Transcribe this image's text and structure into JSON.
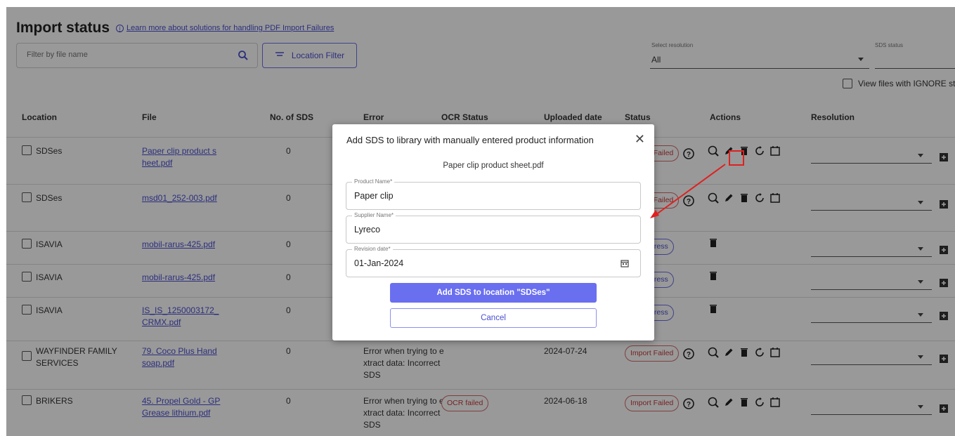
{
  "header": {
    "title": "Import status",
    "info_link": "Learn more about solutions for handling PDF Import Failures"
  },
  "filters": {
    "search_placeholder": "Filter by file name",
    "location_filter_label": "Location Filter",
    "resolution_label": "Select resolution",
    "resolution_value": "All",
    "sds_status_label": "SDS status",
    "ignore_label": "View files with IGNORE st"
  },
  "table": {
    "columns": [
      "Location",
      "File",
      "No. of SDS",
      "Error",
      "OCR Status",
      "Uploaded date",
      "Status",
      "Actions",
      "Resolution"
    ],
    "rows": [
      {
        "location": "SDSes",
        "file": "Paper clip product sheet.pdf",
        "nsds": "0",
        "error": "",
        "ocr": "",
        "date": "",
        "status": "Import Failed",
        "actions": "full"
      },
      {
        "location": "SDSes",
        "file": "msd01_252-003.pdf",
        "nsds": "0",
        "error": "",
        "ocr": "",
        "date": "",
        "status": "Import Failed",
        "actions": "full"
      },
      {
        "location": "ISAVIA",
        "file": "mobil-rarus-425.pdf",
        "nsds": "0",
        "error": "",
        "ocr": "",
        "date": "",
        "status": "In Progress",
        "actions": "delete"
      },
      {
        "location": "ISAVIA",
        "file": "mobil-rarus-425.pdf",
        "nsds": "0",
        "error": "",
        "ocr": "",
        "date": "",
        "status": "In Progress",
        "actions": "delete"
      },
      {
        "location": "ISAVIA",
        "file": "IS_IS_1250003172_CRMX.pdf",
        "nsds": "0",
        "error": "",
        "ocr": "",
        "date": "",
        "status": "In Progress",
        "actions": "delete"
      },
      {
        "location": "WAYFINDER FAMILY SERVICES",
        "file": "79. Coco Plus Hand soap.pdf",
        "nsds": "0",
        "error": "Error when trying to extract data: Incorrect SDS",
        "ocr": "",
        "date": "2024-07-24",
        "status": "Import Failed",
        "actions": "full"
      },
      {
        "location": "BRIKERS",
        "file": "45. Propel Gold - GP Grease lithium.pdf",
        "nsds": "0",
        "error": "Error when trying to extract data: Incorrect SDS",
        "ocr": "OCR failed",
        "date": "2024-06-18",
        "status": "Import Failed",
        "actions": "full"
      }
    ]
  },
  "modal": {
    "title": "Add SDS to library with manually entered product information",
    "file_name": "Paper clip product sheet.pdf",
    "product_name_label": "Product Name*",
    "product_name_value": "Paper clip",
    "supplier_name_label": "Supplier Name*",
    "supplier_name_value": "Lyreco",
    "revision_date_label": "Revision date*",
    "revision_date_value": "01-Jan-2024",
    "submit_label": "Add SDS to location \"SDSes\"",
    "cancel_label": "Cancel"
  },
  "colors": {
    "accent": "#6a6ff0",
    "link": "#4a4fd0",
    "error": "#c43a3a",
    "annotation": "#e02020"
  }
}
